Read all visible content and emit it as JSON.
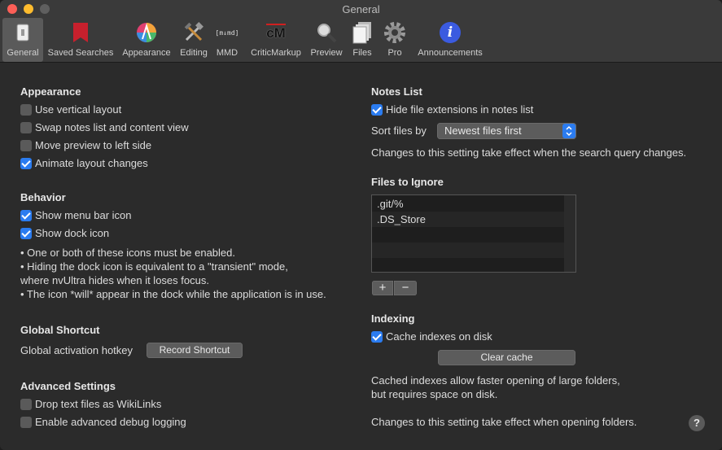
{
  "window": {
    "title": "General"
  },
  "toolbar": {
    "items": [
      {
        "label": "General",
        "icon": "general-icon"
      },
      {
        "label": "Saved Searches",
        "icon": "bookmark-icon"
      },
      {
        "label": "Appearance",
        "icon": "color-wheel-icon"
      },
      {
        "label": "Editing",
        "icon": "tools-icon"
      },
      {
        "label": "MMD",
        "icon": "mmd-icon",
        "icon_text": "[m↓md]"
      },
      {
        "label": "CriticMarkup",
        "icon": "criticmarkup-icon",
        "icon_text": "cM"
      },
      {
        "label": "Preview",
        "icon": "magnifier-icon"
      },
      {
        "label": "Files",
        "icon": "files-icon"
      },
      {
        "label": "Pro",
        "icon": "gear-icon"
      },
      {
        "label": "Announcements",
        "icon": "info-icon",
        "icon_text": "i"
      }
    ]
  },
  "appearance": {
    "heading": "Appearance",
    "options": [
      {
        "label": "Use vertical layout",
        "checked": false
      },
      {
        "label": "Swap notes list and content view",
        "checked": false
      },
      {
        "label": "Move preview to left side",
        "checked": false
      },
      {
        "label": "Animate layout changes",
        "checked": true
      }
    ]
  },
  "behavior": {
    "heading": "Behavior",
    "options": [
      {
        "label": "Show menu bar icon",
        "checked": true
      },
      {
        "label": "Show dock icon",
        "checked": true
      }
    ],
    "notes": [
      "• One or both of these icons must be enabled.",
      "• Hiding the dock icon is equivalent to a \"transient\" mode,",
      "where nvUltra hides when it loses focus.",
      "• The icon *will* appear in the dock while the application is in use."
    ]
  },
  "shortcut": {
    "heading": "Global Shortcut",
    "label": "Global activation hotkey",
    "button": "Record Shortcut"
  },
  "advanced": {
    "heading": "Advanced Settings",
    "options": [
      {
        "label": "Drop text files as WikiLinks",
        "checked": false
      },
      {
        "label": "Enable advanced debug logging",
        "checked": false
      }
    ]
  },
  "notes_list": {
    "heading": "Notes List",
    "hide_ext": {
      "label": "Hide file extensions in notes list",
      "checked": true
    },
    "sort_label": "Sort files by",
    "sort_value": "Newest files first",
    "note": "Changes to this setting take effect when the search query changes."
  },
  "ignore": {
    "heading": "Files to Ignore",
    "items": [
      ".git/%",
      ".DS_Store"
    ],
    "add": "+",
    "remove": "−"
  },
  "indexing": {
    "heading": "Indexing",
    "cache": {
      "label": "Cache indexes on disk",
      "checked": true
    },
    "clear_button": "Clear cache",
    "note1": "Cached indexes allow faster opening of large folders,",
    "note2": "but requires space on disk.",
    "note3": "Changes to this setting take effect when opening folders."
  },
  "help": "?",
  "colors": {
    "accent": "#2b7cf0",
    "background": "#2b2b2b",
    "toolbar": "#3a3a3a"
  }
}
